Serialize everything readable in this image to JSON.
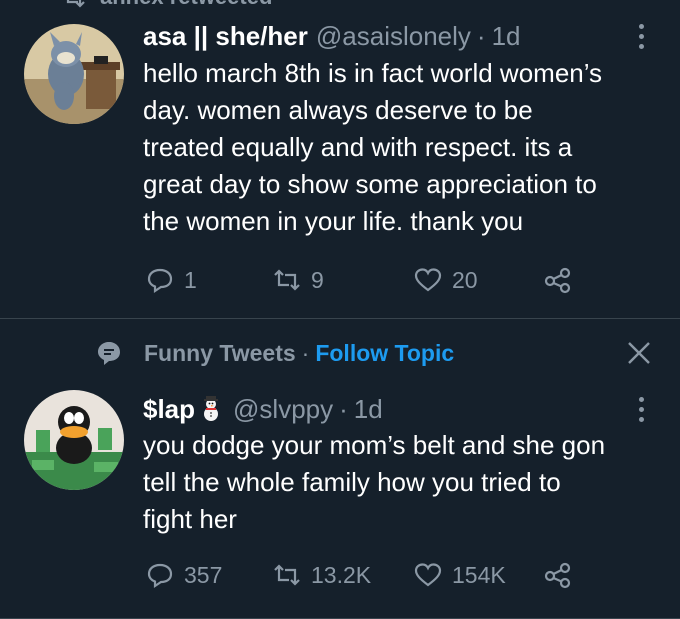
{
  "retweet_header": {
    "label": "annex retweeted"
  },
  "tweet1": {
    "name": "asa || she/her",
    "handle": "@asaislonely",
    "separator": "·",
    "time": "1d",
    "lines": [
      "hello march 8th is in fact world women’s",
      "day. women always deserve to be",
      "treated equally and with respect. its a",
      "great day to show some appreciation to",
      "the women in your life. thank you"
    ],
    "replies": "1",
    "retweets": "9",
    "likes": "20"
  },
  "tweet2": {
    "topic_name": "Funny Tweets",
    "topic_separator": "·",
    "follow_topic": "Follow Topic",
    "name": "$lap",
    "handle": "@slvppy",
    "separator": "·",
    "time": "1d",
    "lines": [
      "you dodge your mom’s belt and she gon",
      "tell the whole family how you tried to",
      "fight her"
    ],
    "replies": "357",
    "retweets": "13.2K",
    "likes": "154K"
  },
  "colors": {
    "background": "#15202b",
    "secondary_text": "#8b98a5",
    "accent": "#1d9bf0",
    "divider": "#38444d"
  },
  "icons": [
    "retweet-icon",
    "reply-icon",
    "like-icon",
    "share-icon",
    "more-icon",
    "topic-icon",
    "close-icon"
  ]
}
